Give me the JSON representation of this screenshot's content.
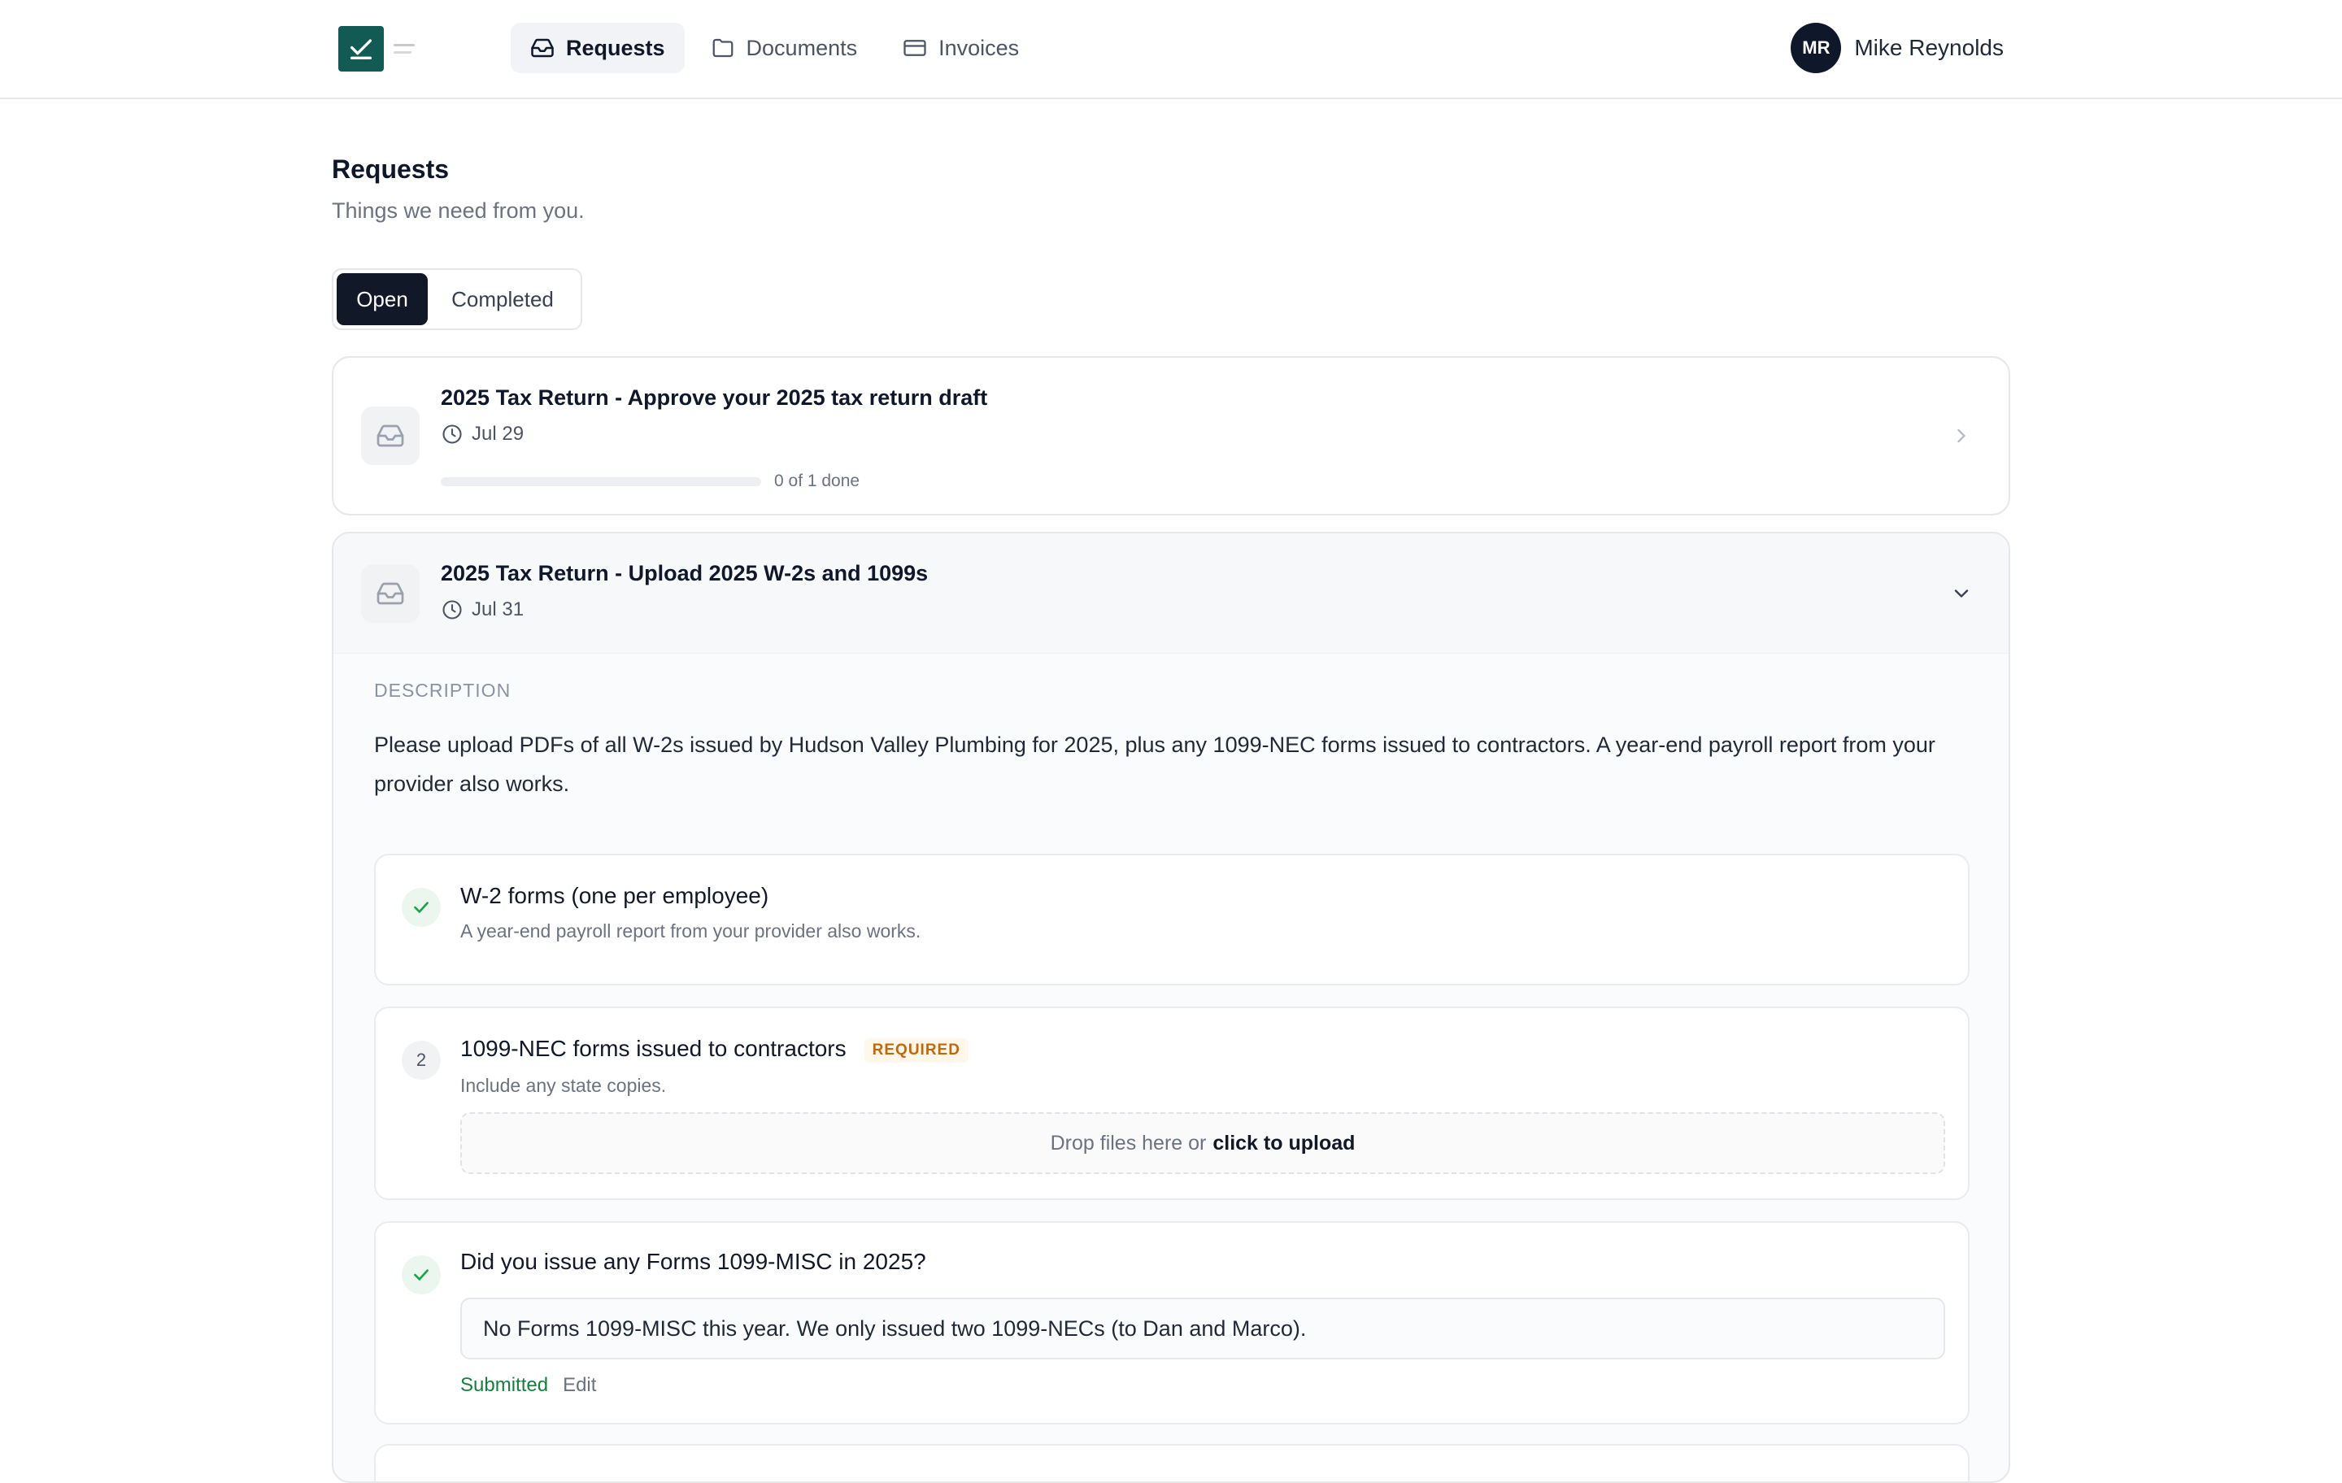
{
  "header": {
    "nav": [
      {
        "label": "Requests",
        "icon": "inbox-icon",
        "active": true
      },
      {
        "label": "Documents",
        "icon": "folder-icon",
        "active": false
      },
      {
        "label": "Invoices",
        "icon": "card-icon",
        "active": false
      }
    ],
    "user": {
      "initials": "MR",
      "name": "Mike Reynolds"
    }
  },
  "page": {
    "title": "Requests",
    "subtitle": "Things we need from you.",
    "filters": {
      "open": "Open",
      "completed": "Completed",
      "selected": "Open"
    }
  },
  "requests": [
    {
      "title": "2025 Tax Return - Approve your 2025 tax return draft",
      "due": "Jul 29",
      "progress": {
        "done": 0,
        "total": 1,
        "label": "0 of 1 done"
      },
      "expanded": false
    },
    {
      "title": "2025 Tax Return - Upload 2025 W-2s and 1099s",
      "due": "Jul 31",
      "expanded": true,
      "description_label": "DESCRIPTION",
      "description": "Please upload PDFs of all W-2s issued by Hudson Valley Plumbing for 2025, plus any 1099-NEC forms issued to contractors. A year-end payroll report from your provider also works.",
      "items": [
        {
          "status": "done",
          "title": "W-2 forms (one per employee)",
          "subtitle": "A year-end payroll report from your provider also works."
        },
        {
          "status": "pending",
          "number": "2",
          "title": "1099-NEC forms issued to contractors",
          "tag": "REQUIRED",
          "subtitle": "Include any state copies.",
          "dropzone": {
            "text": "Drop files here or",
            "link": "click to upload"
          }
        },
        {
          "status": "done",
          "title": "Did you issue any Forms 1099-MISC in 2025?",
          "answer": "No Forms 1099-MISC this year. We only issued two 1099-NECs (to Dan and Marco).",
          "status_label": "Submitted",
          "edit_label": "Edit"
        }
      ]
    }
  ],
  "colors": {
    "brand": "#125a54",
    "dark": "#111827",
    "success": "#15803d",
    "warning": "#c2670a"
  }
}
